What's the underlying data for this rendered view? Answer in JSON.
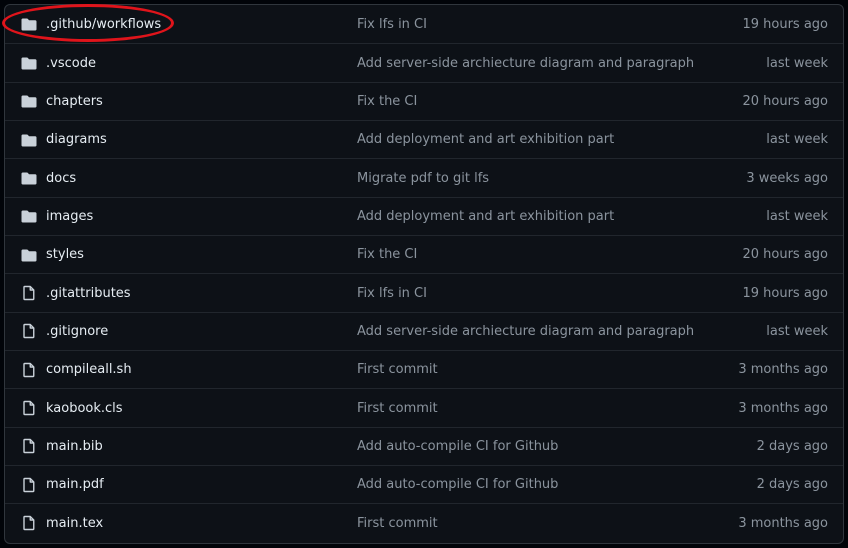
{
  "files": [
    {
      "name": ".github/workflows",
      "type": "folder",
      "message": "Fix lfs in CI",
      "time": "19 hours ago"
    },
    {
      "name": ".vscode",
      "type": "folder",
      "message": "Add server-side archiecture diagram and paragraph",
      "time": "last week"
    },
    {
      "name": "chapters",
      "type": "folder",
      "message": "Fix the CI",
      "time": "20 hours ago"
    },
    {
      "name": "diagrams",
      "type": "folder",
      "message": "Add deployment and art exhibition part",
      "time": "last week"
    },
    {
      "name": "docs",
      "type": "folder",
      "message": "Migrate pdf to git lfs",
      "time": "3 weeks ago"
    },
    {
      "name": "images",
      "type": "folder",
      "message": "Add deployment and art exhibition part",
      "time": "last week"
    },
    {
      "name": "styles",
      "type": "folder",
      "message": "Fix the CI",
      "time": "20 hours ago"
    },
    {
      "name": ".gitattributes",
      "type": "file",
      "message": "Fix lfs in CI",
      "time": "19 hours ago"
    },
    {
      "name": ".gitignore",
      "type": "file",
      "message": "Add server-side archiecture diagram and paragraph",
      "time": "last week"
    },
    {
      "name": "compileall.sh",
      "type": "file",
      "message": "First commit",
      "time": "3 months ago"
    },
    {
      "name": "kaobook.cls",
      "type": "file",
      "message": "First commit",
      "time": "3 months ago"
    },
    {
      "name": "main.bib",
      "type": "file",
      "message": "Add auto-compile CI for Github",
      "time": "2 days ago"
    },
    {
      "name": "main.pdf",
      "type": "file",
      "message": "Add auto-compile CI for Github",
      "time": "2 days ago"
    },
    {
      "name": "main.tex",
      "type": "file",
      "message": "First commit",
      "time": "3 months ago"
    }
  ],
  "icons": {
    "folder": "folder-icon",
    "file": "file-icon"
  },
  "colors": {
    "highlight": "#e0141b",
    "text": "#e6edf3",
    "muted": "#8b949e"
  }
}
